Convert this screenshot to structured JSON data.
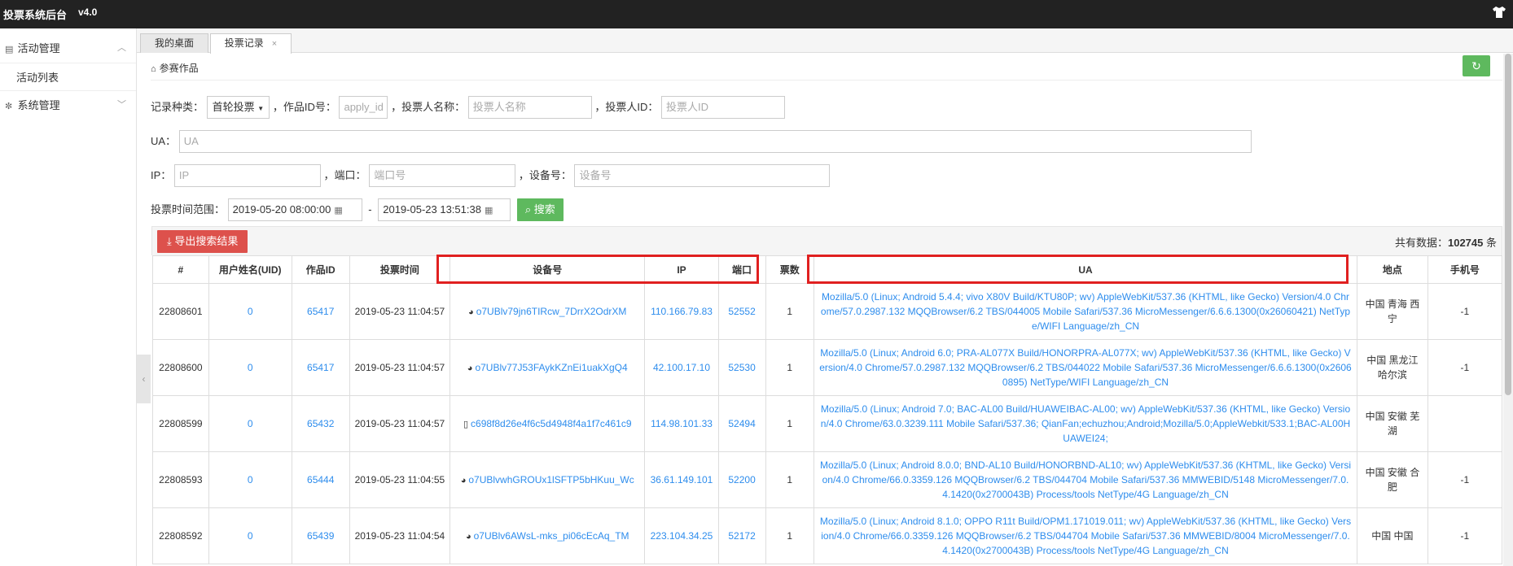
{
  "app": {
    "title": "投票系统后台",
    "version": "v4.0"
  },
  "sidebar": {
    "groups": [
      {
        "label": "活动管理",
        "items": [
          "活动列表"
        ]
      },
      {
        "label": "系统管理",
        "items": []
      }
    ]
  },
  "tabs": [
    {
      "label": "我的桌面",
      "active": false
    },
    {
      "label": "投票记录",
      "active": true,
      "close": "×"
    }
  ],
  "breadcrumb": "参赛作品",
  "filters": {
    "type_label": "记录种类：",
    "type_value": "首轮投票",
    "apply_label": "，作品ID号：",
    "apply_placeholder": "apply_id",
    "voter_name_label": "，投票人名称：",
    "voter_name_placeholder": "投票人名称",
    "voter_id_label": "，投票人ID：",
    "voter_id_placeholder": "投票人ID",
    "ua_label": "UA：",
    "ua_placeholder": "UA",
    "ip_label": "IP：",
    "ip_placeholder": "IP",
    "port_label": "，端口：",
    "port_placeholder": "端口号",
    "device_label": "，设备号：",
    "device_placeholder": "设备号",
    "time_label": "投票时间范围：",
    "time_start": "2019-05-20 08:00:00",
    "time_dash": "-",
    "time_end": "2019-05-23 13:51:38",
    "search_label": "搜索"
  },
  "export_label": "导出搜索结果",
  "total": {
    "prefix": "共有数据：",
    "count": "102745",
    "suffix": " 条"
  },
  "columns": [
    "#",
    "用户姓名(UID)",
    "作品ID",
    "投票时间",
    "设备号",
    "IP",
    "端口",
    "票数",
    "UA",
    "地点",
    "手机号"
  ],
  "rows": [
    {
      "id": "22808601",
      "uid": "0",
      "work_id": "65417",
      "time": "2019-05-23 11:04:57",
      "device_icon": "wechat-icon",
      "device": "o7UBlv79jn6TIRcw_7DrrX2OdrXM",
      "ip": "110.166.79.83",
      "port": "52552",
      "votes": "1",
      "ua": "Mozilla/5.0 (Linux; Android 5.4.4; vivo X80V Build/KTU80P; wv) AppleWebKit/537.36 (KHTML, like Gecko) Version/4.0 Chrome/57.0.2987.132 MQQBrowser/6.2 TBS/044005 Mobile Safari/537.36 MicroMessenger/6.6.6.1300(0x26060421) NetType/WIFI Language/zh_CN",
      "location": "中国 青海 西宁",
      "phone": "-1"
    },
    {
      "id": "22808600",
      "uid": "0",
      "work_id": "65417",
      "time": "2019-05-23 11:04:57",
      "device_icon": "wechat-icon",
      "device": "o7UBlv77J53FAykKZnEi1uakXgQ4",
      "ip": "42.100.17.10",
      "port": "52530",
      "votes": "1",
      "ua": "Mozilla/5.0 (Linux; Android 6.0; PRA-AL077X Build/HONORPRA-AL077X; wv) AppleWebKit/537.36 (KHTML, like Gecko) Version/4.0 Chrome/57.0.2987.132 MQQBrowser/6.2 TBS/044022 Mobile Safari/537.36 MicroMessenger/6.6.6.1300(0x26060895) NetType/WIFI Language/zh_CN",
      "location": "中国 黑龙江 哈尔滨",
      "phone": "-1"
    },
    {
      "id": "22808599",
      "uid": "0",
      "work_id": "65432",
      "time": "2019-05-23 11:04:57",
      "device_icon": "mobile-icon",
      "device": "c698f8d26e4f6c5d4948f4a1f7c461c9",
      "ip": "114.98.101.33",
      "port": "52494",
      "votes": "1",
      "ua": "Mozilla/5.0 (Linux; Android 7.0; BAC-AL00 Build/HUAWEIBAC-AL00; wv) AppleWebKit/537.36 (KHTML, like Gecko) Version/4.0 Chrome/63.0.3239.111 Mobile Safari/537.36; QianFan;echuzhou;Android;Mozilla/5.0;AppleWebkit/533.1;BAC-AL00HUAWEI24;",
      "location": "中国 安徽 芜湖",
      "phone": ""
    },
    {
      "id": "22808593",
      "uid": "0",
      "work_id": "65444",
      "time": "2019-05-23 11:04:55",
      "device_icon": "wechat-icon",
      "device": "o7UBlvwhGROUx1lSFTP5bHKuu_Wc",
      "ip": "36.61.149.101",
      "port": "52200",
      "votes": "1",
      "ua": "Mozilla/5.0 (Linux; Android 8.0.0; BND-AL10 Build/HONORBND-AL10; wv) AppleWebKit/537.36 (KHTML, like Gecko) Version/4.0 Chrome/66.0.3359.126 MQQBrowser/6.2 TBS/044704 Mobile Safari/537.36 MMWEBID/5148 MicroMessenger/7.0.4.1420(0x2700043B) Process/tools NetType/4G Language/zh_CN",
      "location": "中国 安徽 合肥",
      "phone": "-1"
    },
    {
      "id": "22808592",
      "uid": "0",
      "work_id": "65439",
      "time": "2019-05-23 11:04:54",
      "device_icon": "wechat-icon",
      "device": "o7UBlv6AWsL-mks_pi06cEcAq_TM",
      "ip": "223.104.34.25",
      "port": "52172",
      "votes": "1",
      "ua": "Mozilla/5.0 (Linux; Android 8.1.0; OPPO R11t Build/OPM1.171019.011; wv) AppleWebKit/537.36 (KHTML, like Gecko) Version/4.0 Chrome/66.0.3359.126 MQQBrowser/6.2 TBS/044704 Mobile Safari/537.36 MMWEBID/8004 MicroMessenger/7.0.4.1420(0x2700043B) Process/tools NetType/4G Language/zh_CN",
      "location": "中国 中国",
      "phone": "-1"
    }
  ],
  "colors": {
    "topbar": "#222222",
    "link": "#2e8ded",
    "success": "#5eb95e",
    "danger": "#dd514c",
    "highlight": "#e02020"
  }
}
